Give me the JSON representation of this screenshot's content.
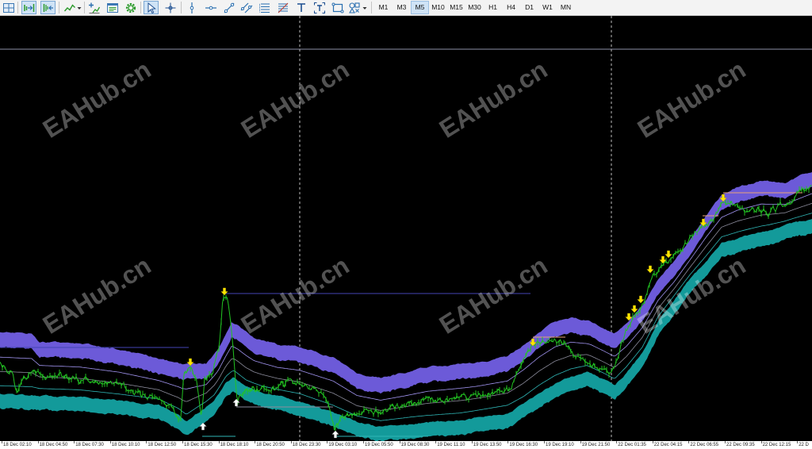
{
  "toolbar": {
    "icons": [
      "tile-windows-icon",
      "auto-scroll-icon",
      "chart-shift-icon",
      "line-chart-icon",
      "chevron-down-icon",
      "indicators-icon",
      "templates-icon",
      "experts-gear-icon",
      "cursor-icon",
      "crosshair-icon",
      "vertical-line-icon",
      "horizontal-line-icon",
      "trend-line-icon",
      "channel-icon",
      "fibonacci-icon",
      "fibonacci-fan-icon",
      "text-icon",
      "text-label-icon",
      "rectangle-icon",
      "shapes-icon",
      "chevron-down-icon"
    ],
    "timeframes": [
      {
        "label": "M1",
        "active": false
      },
      {
        "label": "M3",
        "active": false
      },
      {
        "label": "M5",
        "active": true
      },
      {
        "label": "M10",
        "active": false
      },
      {
        "label": "M15",
        "active": false
      },
      {
        "label": "M30",
        "active": false
      },
      {
        "label": "H1",
        "active": false
      },
      {
        "label": "H4",
        "active": false
      },
      {
        "label": "D1",
        "active": false
      },
      {
        "label": "W1",
        "active": false
      },
      {
        "label": "MN",
        "active": false
      }
    ]
  },
  "chart": {
    "watermark": "EAHub.cn",
    "time_axis": [
      "18 Dec 02:10",
      "18 Dec 04:50",
      "18 Dec 07:30",
      "18 Dec 10:10",
      "18 Dec 12:50",
      "18 Dec 15:30",
      "18 Dec 18:10",
      "18 Dec 20:50",
      "18 Dec 23:30",
      "19 Dec 03:10",
      "19 Dec 05:50",
      "19 Dec 08:30",
      "19 Dec 11:10",
      "19 Dec 13:50",
      "19 Dec 16:30",
      "19 Dec 19:10",
      "19 Dec 21:50",
      "22 Dec 01:35",
      "22 Dec 04:15",
      "22 Dec 06:55",
      "22 Dec 09:35",
      "22 Dec 12:15",
      "22 D"
    ],
    "colors": {
      "background": "#000000",
      "price": "#22c422",
      "upper_band": "#6c5ad8",
      "lower_band": "#139a9a",
      "upper_line": "#a194f0",
      "middle_line": "#8c8c9c",
      "lower_line": "#2fb6b6",
      "level_line": "#4444b4",
      "target_line": "#e8a37a",
      "top_line": "#8d8fa8",
      "signal_down": "#ffe600",
      "signal_up": "#ffffff",
      "separator": "#bdbdbd",
      "watermark": "#ffffff"
    }
  }
}
